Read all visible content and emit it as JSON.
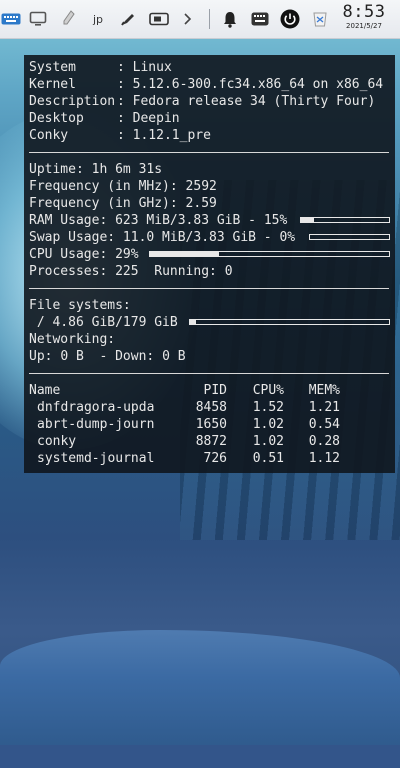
{
  "colors": {
    "panel_bg": "#eef0f3",
    "conky_bg": "#10161e",
    "conky_text": "#e8e8e8",
    "icon_dark": "#333333"
  },
  "panel": {
    "icons": [
      "keyboard-icon",
      "desktop-icon",
      "pin-icon",
      "ime-icon",
      "pen-icon",
      "card-reader-icon",
      "chevron-right-icon",
      "bell-icon",
      "onscreen-keyboard-icon",
      "power-icon",
      "trash-icon"
    ],
    "ime_label": "jp",
    "clock_time": "8:53",
    "clock_date": "2021/5/27"
  },
  "conky": {
    "system": {
      "system_label": "System",
      "system_value": "Linux",
      "kernel_label": "Kernel",
      "kernel_value": "5.12.6-300.fc34.x86_64 on x86_64",
      "description_label": "Description",
      "description_value": "Fedora release 34 (Thirty Four)",
      "desktop_label": "Desktop",
      "desktop_value": "Deepin",
      "conky_label": "Conky",
      "conky_value": "1.12.1_pre"
    },
    "stats": {
      "uptime_label": "Uptime:",
      "uptime_value": "1h 6m 31s",
      "freq_mhz_label": "Frequency (in MHz):",
      "freq_mhz_value": "2592",
      "freq_ghz_label": "Frequency (in GHz):",
      "freq_ghz_value": "2.59",
      "ram_label": "RAM Usage:",
      "ram_value": "623 MiB/3.83 GiB - 15%",
      "ram_percent": 15,
      "swap_label": "Swap Usage:",
      "swap_value": "11.0 MiB/3.83 GiB - 0%",
      "swap_percent": 0,
      "cpu_label": "CPU Usage:",
      "cpu_value": "29%",
      "cpu_percent": 29,
      "processes_label": "Processes:",
      "processes_value": "225",
      "running_label": "Running:",
      "running_value": "0"
    },
    "fs": {
      "filesystems_label": "File systems:",
      "root_value": " / 4.86 GiB/179 GiB",
      "root_percent": 3,
      "networking_label": "Networking:",
      "up_label": "Up:",
      "up_value": "0 B",
      "down_label": "- Down:",
      "down_value": "0 B"
    },
    "processes": {
      "headers": {
        "name": "Name",
        "pid": "PID",
        "cpu": "CPU%",
        "mem": "MEM%"
      },
      "rows": [
        {
          "name": "dnfdragora-upda",
          "pid": "8458",
          "cpu": "1.52",
          "mem": "1.21"
        },
        {
          "name": "abrt-dump-journ",
          "pid": "1650",
          "cpu": "1.02",
          "mem": "0.54"
        },
        {
          "name": "conky",
          "pid": "8872",
          "cpu": "1.02",
          "mem": "0.28"
        },
        {
          "name": "systemd-journal",
          "pid": "726",
          "cpu": "0.51",
          "mem": "1.12"
        }
      ]
    }
  }
}
